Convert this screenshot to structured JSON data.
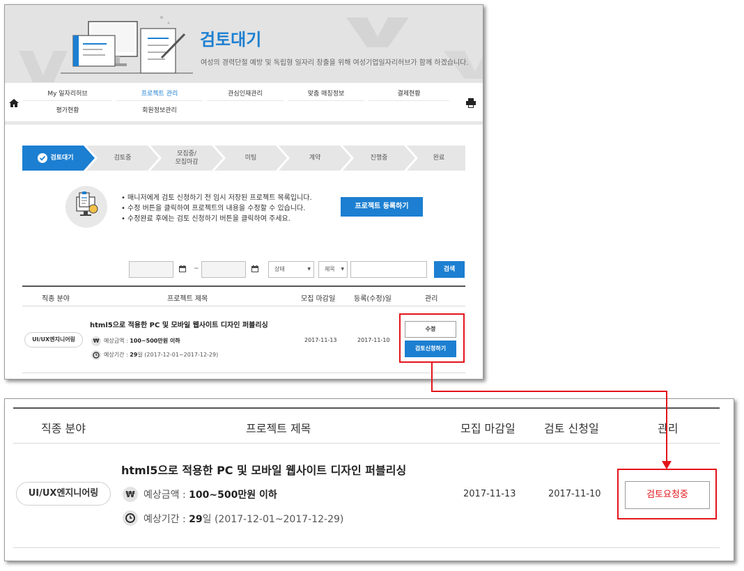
{
  "banner": {
    "title": "검토대기",
    "subtitle": "여성의 경력단절 예방 및 독립형 일자리 창출을 위해 여성기업일자리허브가 함께 하겠습니다."
  },
  "gnb": {
    "items": [
      {
        "label": "My 일자리허브",
        "active": false
      },
      {
        "label": "프로젝트 관리",
        "active": true
      },
      {
        "label": "관심인재관리",
        "active": false
      },
      {
        "label": "맞춤 매칭정보",
        "active": false
      },
      {
        "label": "결제현황",
        "active": false
      },
      {
        "label": "평가현황",
        "active": false
      },
      {
        "label": "회원정보관리",
        "active": false
      }
    ]
  },
  "steps": [
    {
      "label": "검토대기",
      "active": true
    },
    {
      "label": "검토중",
      "active": false
    },
    {
      "label": "모집중/\n모집마감",
      "active": false
    },
    {
      "label": "미팅",
      "active": false
    },
    {
      "label": "계약",
      "active": false
    },
    {
      "label": "진행중",
      "active": false
    },
    {
      "label": "완료",
      "active": false
    }
  ],
  "guide": {
    "lines": [
      "매니저에게 검토 신청하기 전 임시 저장된 프로젝트 목록입니다.",
      "수정 버튼을 클릭하여 프로젝트의 내용을 수정할 수 있습니다.",
      "수정완료 후에는 검토 신청하기 버튼을 클릭하여 주세요."
    ],
    "register_button": "프로젝트 등록하기"
  },
  "search": {
    "date_separator": "~",
    "status_select": "상태",
    "field_select": "제목",
    "search_button": "검색"
  },
  "table1": {
    "headers": [
      "직종 분야",
      "프로젝트 제목",
      "모집 마감일",
      "등록(수정)일",
      "관리"
    ],
    "row": {
      "category": "UI/UX엔지니어링",
      "title": "html5으로 적용한 PC 및 모바일 웹사이트 디자인 퍼블리싱",
      "budget_label": "예상금액 : ",
      "budget_value": "100~500만원 이하",
      "period_label": "예상기간 : ",
      "period_days": "29",
      "period_unit": "일",
      "period_range": "(2017-12-01~2017-12-29)",
      "deadline": "2017-11-13",
      "registered": "2017-11-10",
      "edit_button": "수정",
      "review_button": "검토신청하기"
    }
  },
  "table2": {
    "headers": [
      "직종 분야",
      "프로젝트 제목",
      "모집 마감일",
      "검토 신청일",
      "관리"
    ],
    "row": {
      "category": "UI/UX엔지니어링",
      "title": "html5으로 적용한 PC 및 모바일 웹사이트 디자인 퍼블리싱",
      "budget_label": "예상금액 : ",
      "budget_value": "100~500만원 이하",
      "period_label": "예상기간 : ",
      "period_days": "29",
      "period_unit": "일",
      "period_range": "(2017-12-01~2017-12-29)",
      "deadline": "2017-11-13",
      "review_date": "2017-11-10",
      "status_button": "검토요청중"
    }
  },
  "icons": {
    "won": "₩",
    "clock": "clock-icon",
    "home": "home-icon",
    "print": "printer-icon",
    "calendar": "calendar-icon",
    "check": "check-circle-icon"
  },
  "colors": {
    "primary": "#1c7fd1",
    "highlight": "#e3141a",
    "step_inactive": "#e6e6e6"
  }
}
